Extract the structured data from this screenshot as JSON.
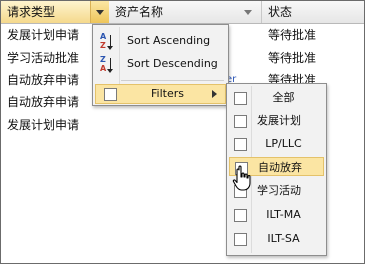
{
  "grid": {
    "columns": [
      "请求类型",
      "资产名称",
      "状态"
    ],
    "rows": [
      {
        "type": "发展计划申请",
        "asset": "",
        "status": "等待批准"
      },
      {
        "type": "学习活动批准",
        "asset": "",
        "status": "等待批准"
      },
      {
        "type": "自动放弃申请",
        "asset": "stomer",
        "status": "等待批准"
      },
      {
        "type": "自动放弃申请",
        "asset": "",
        "status": ""
      },
      {
        "type": "发展计划申请",
        "asset": "",
        "status": ""
      }
    ]
  },
  "column_menu": {
    "sort_ascending": "Sort Ascending",
    "sort_descending": "Sort Descending",
    "filters": "Filters"
  },
  "filter_submenu": {
    "items": [
      "全部",
      "发展计划",
      "LP/LLC",
      "自动放弃",
      "学习活动",
      "ILT-MA",
      "ILT-SA"
    ],
    "highlighted": "自动放弃"
  },
  "icons": {
    "column_trigger": "chevron-down-icon",
    "sort_asc": "sort-ascending-icon",
    "sort_desc": "sort-descending-icon",
    "submenu_arrow": "chevron-right-icon",
    "cursor": "hand-pointer-cursor"
  },
  "colors": {
    "highlight": "#fbe5a3",
    "header_active": "#f5d98c"
  }
}
